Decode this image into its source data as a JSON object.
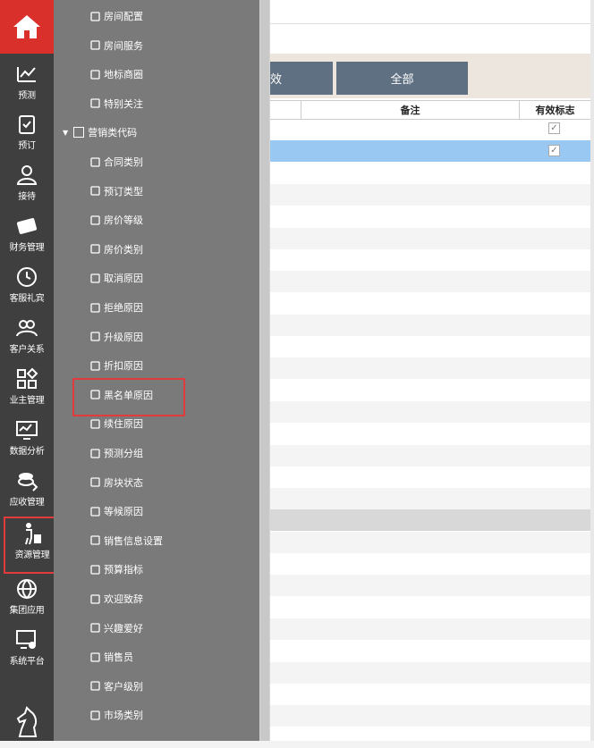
{
  "rail": {
    "items": [
      {
        "label": "预测",
        "icon": "chart-trend-icon"
      },
      {
        "label": "预订",
        "icon": "clipboard-check-icon"
      },
      {
        "label": "接待",
        "icon": "person-icon"
      },
      {
        "label": "财务管理",
        "icon": "money-icon"
      },
      {
        "label": "客服礼宾",
        "icon": "clock-icon"
      },
      {
        "label": "客户关系",
        "icon": "people-icon"
      },
      {
        "label": "业主管理",
        "icon": "grid-diamond-icon"
      },
      {
        "label": "数据分析",
        "icon": "monitor-chart-icon"
      },
      {
        "label": "应收管理",
        "icon": "coins-icon"
      },
      {
        "label": "资源管理",
        "icon": "luggage-person-icon"
      },
      {
        "label": "集团应用",
        "icon": "globe-icon"
      },
      {
        "label": "系统平台",
        "icon": "screen-gear-icon"
      }
    ],
    "home_icon": "home-icon",
    "bottom_icon": "chess-knight-icon"
  },
  "submenu": {
    "items_top": [
      {
        "label": "房间配置",
        "icon": "sitemap-icon"
      },
      {
        "label": "房间服务",
        "icon": "service-icon"
      },
      {
        "label": "地标商圈",
        "icon": "building-icon"
      },
      {
        "label": "特别关注",
        "icon": "eye-icon"
      }
    ],
    "group_label": "营销类代码",
    "items": [
      {
        "label": "合同类别",
        "icon": "document-icon"
      },
      {
        "label": "预订类型",
        "icon": "headset-icon"
      },
      {
        "label": "房价等级",
        "icon": "a-plus-icon"
      },
      {
        "label": "房价类别",
        "icon": "tag-icon"
      },
      {
        "label": "取消原因",
        "icon": "minus-box-icon"
      },
      {
        "label": "拒绝原因",
        "icon": "ban-icon"
      },
      {
        "label": "升级原因",
        "icon": "upgrade-icon"
      },
      {
        "label": "折扣原因",
        "icon": "question-icon"
      },
      {
        "label": "黑名单原因",
        "icon": "grid-icon"
      },
      {
        "label": "续住原因",
        "icon": "grid-icon"
      },
      {
        "label": "预测分组",
        "icon": "wand-icon"
      },
      {
        "label": "房块状态",
        "icon": "copy-icon"
      },
      {
        "label": "等候原因",
        "icon": "history-icon"
      },
      {
        "label": "销售信息设置",
        "icon": "flask-icon"
      },
      {
        "label": "预算指标",
        "icon": "bar-chart-icon"
      },
      {
        "label": "欢迎致辞",
        "icon": "speech-icon"
      },
      {
        "label": "兴趣爱好",
        "icon": "hobby-icon"
      },
      {
        "label": "销售员",
        "icon": "salesman-icon"
      },
      {
        "label": "客户级别",
        "icon": "a-box-icon"
      },
      {
        "label": "市场类别",
        "icon": "cloud-icon"
      }
    ]
  },
  "toolbar": {
    "btn_partial": "效",
    "btn_all": "全部"
  },
  "grid": {
    "headers": {
      "remark": "备注",
      "valid": "有效标志"
    },
    "rows_checked": [
      true,
      true
    ],
    "check_glyph": "✓"
  }
}
